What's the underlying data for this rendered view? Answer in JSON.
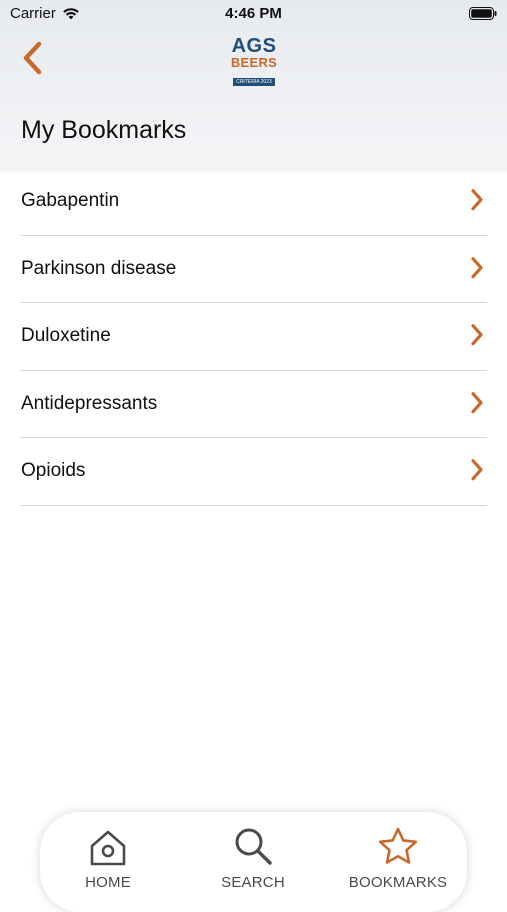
{
  "status_bar": {
    "carrier": "Carrier",
    "time": "4:46 PM"
  },
  "header": {
    "logo": {
      "line1": "AGS",
      "line2": "BEERS",
      "line3": "CRITERIA 2023"
    },
    "title": "My Bookmarks"
  },
  "bookmarks": [
    {
      "label": "Gabapentin"
    },
    {
      "label": "Parkinson disease"
    },
    {
      "label": "Duloxetine"
    },
    {
      "label": "Antidepressants"
    },
    {
      "label": "Opioids"
    }
  ],
  "tabbar": {
    "home": "HOME",
    "search": "SEARCH",
    "bookmarks": "BOOKMARKS",
    "active": "bookmarks"
  },
  "colors": {
    "accent": "#c8692b",
    "brand_blue": "#1f4e79",
    "icon_gray": "#4a4a4a"
  }
}
